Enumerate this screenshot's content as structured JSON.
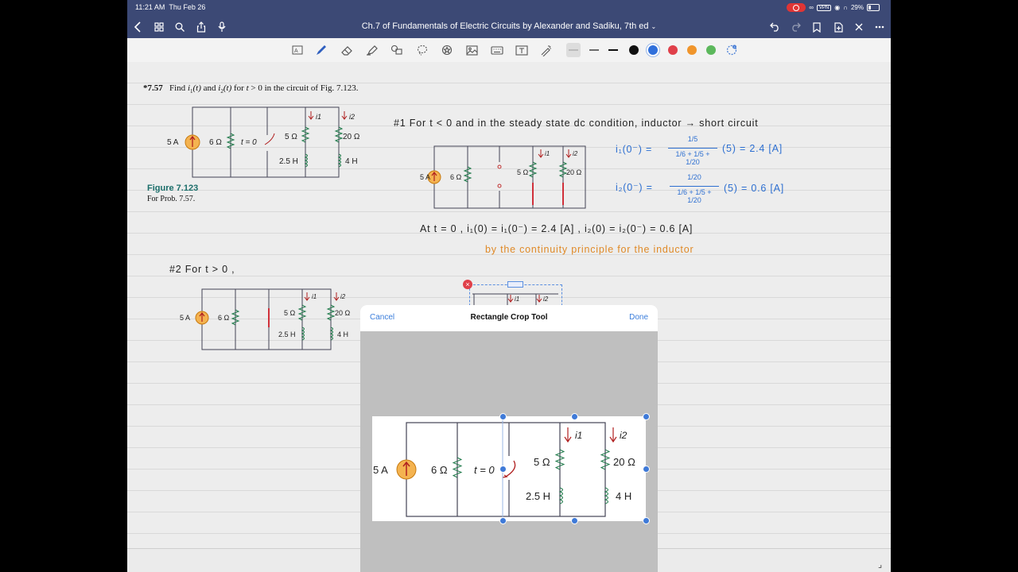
{
  "status_bar": {
    "time": "11:21 AM",
    "date": "Thu Feb 26",
    "vpn": "VPN",
    "battery": "29%"
  },
  "nav": {
    "doc_title": "Ch.7 of Fundamentals of Electric Circuits by Alexander and Sadiku, 7th ed",
    "back_icon": "chevron-left-icon",
    "grid_icon": "grid-icon",
    "search_icon": "search-icon",
    "share_icon": "share-icon",
    "mic_icon": "microphone-icon",
    "undo_icon": "undo-icon",
    "redo_icon": "redo-icon",
    "bookmark_icon": "bookmark-icon",
    "add_page_icon": "add-page-icon",
    "close_icon": "close-icon",
    "more_icon": "more-icon"
  },
  "toolbar": {
    "colors": [
      "#111111",
      "#2f6fdb",
      "#e0404a",
      "#f0952b",
      "#5cb85c"
    ]
  },
  "problem": {
    "number": "*7.57",
    "text_a": "Find ",
    "i1": "i",
    "i1_sub": "1",
    "t_arg": "(t)",
    "and": " and ",
    "i2": "i",
    "i2_sub": "2",
    "text_b": " for ",
    "t_italic": "t",
    "text_c": " > 0 in the circuit of Fig. 7.123.",
    "figure_label": "Figure 7.123",
    "figure_caption": "For Prob. 7.57."
  },
  "circuit": {
    "source": "5 A",
    "r6": "6 Ω",
    "switch": "t = 0",
    "r5": "5 Ω",
    "l25": "2.5 H",
    "r20": "20 Ω",
    "l4": "4 H",
    "i1": "i1",
    "i2": "i2"
  },
  "notes": {
    "line1": "#1  For  t < 0  and  in the  steady state dc  condition,  inductor  → short circuit",
    "eq1_lhs": "i₁(0⁻) =",
    "eq1_num": "1/5",
    "eq1_den": "1/6 + 1/5 + 1/20",
    "eq1_rhs": "(5)  =  2.4  [A]",
    "eq2_lhs": "i₂(0⁻) =",
    "eq2_num": "1/20",
    "eq2_den": "1/6 + 1/5 + 1/20",
    "eq2_rhs": "(5)  =  0.6  [A]",
    "line_t0": "At  t = 0 ,    i₁(0) = i₁(0⁻) = 2.4  [A] ,     i₂(0) = i₂(0⁻) = 0.6  [A]",
    "continuity": "by  the  continuity  principle  for  the  inductor",
    "line2": "#2   For  t > 0 ,"
  },
  "dialog": {
    "cancel": "Cancel",
    "title": "Rectangle Crop Tool",
    "done": "Done"
  }
}
